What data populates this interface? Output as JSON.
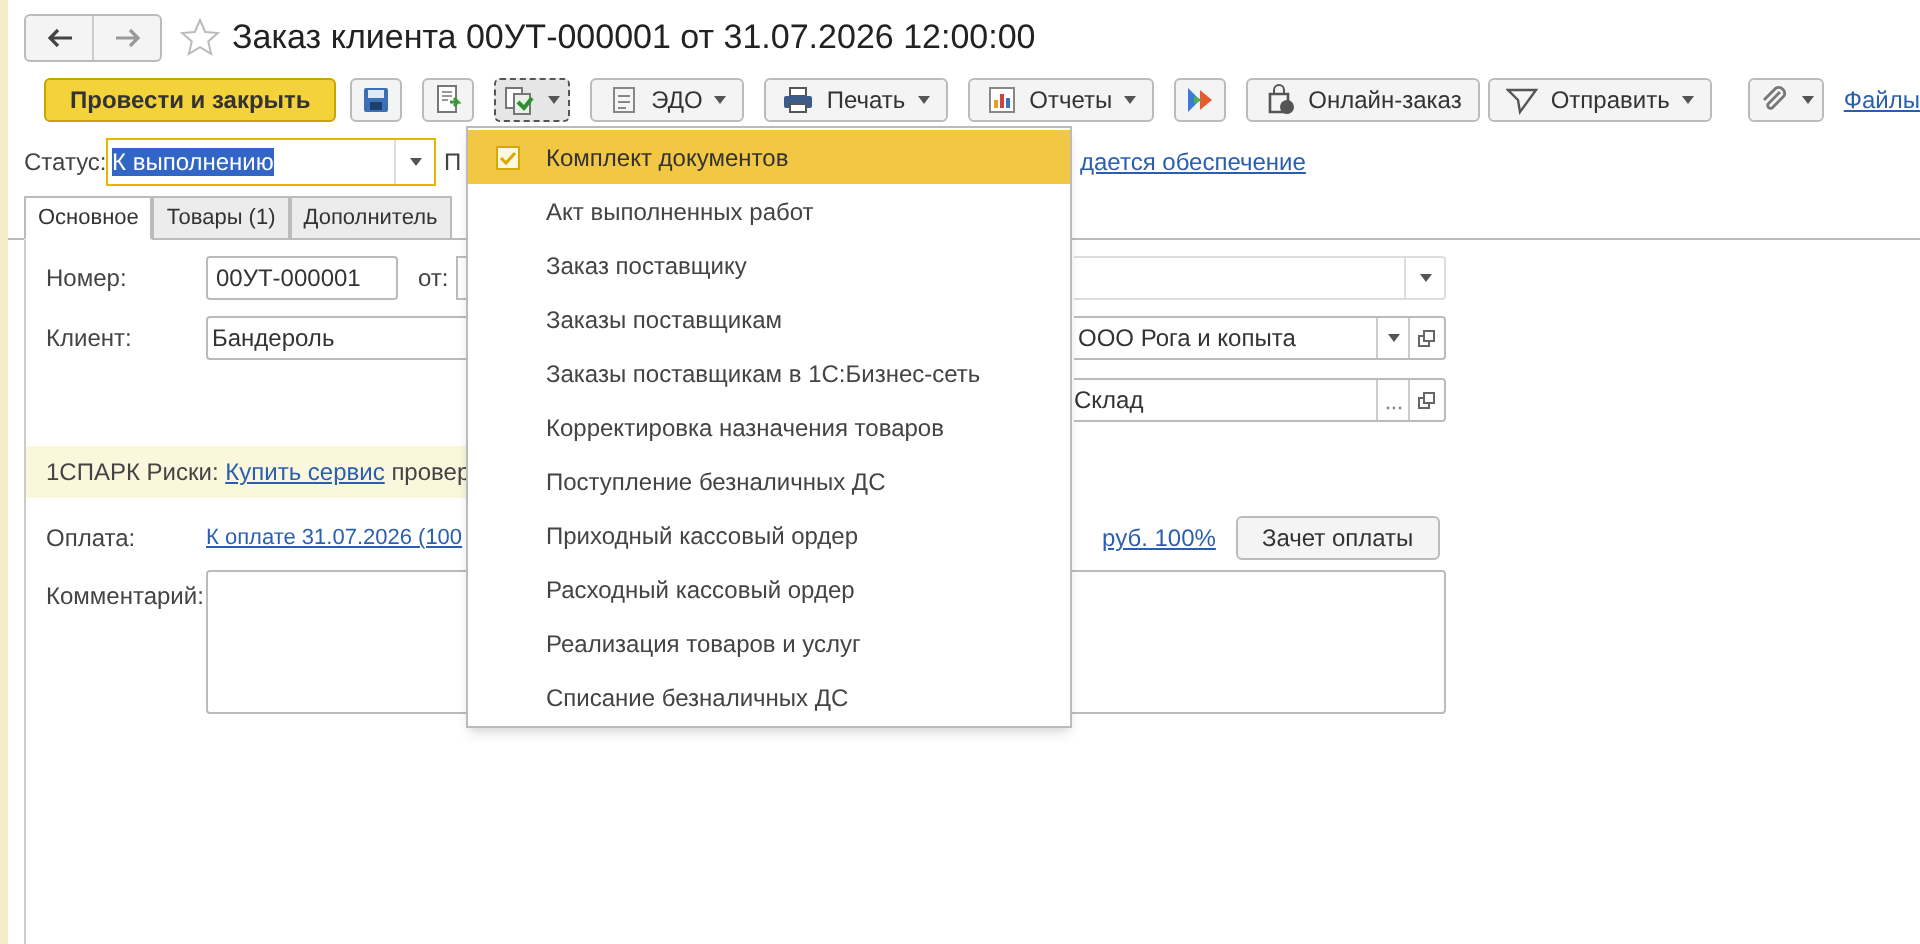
{
  "window": {
    "title": "Заказ клиента 00УТ-000001 от 31.07.2026 12:00:00",
    "favorite": false
  },
  "toolbar": [
    {
      "kind": "primary",
      "label": "Провести и закрыть"
    },
    {
      "kind": "icon"
    },
    {
      "kind": "icon"
    },
    {
      "kind": "menu-icon",
      "selected": true
    },
    {
      "kind": "dropdown",
      "label": "ЭДО"
    },
    {
      "kind": "dropdown",
      "label": "Печать"
    },
    {
      "kind": "dropdown",
      "label": "Отчеты"
    },
    {
      "kind": "icon"
    },
    {
      "kind": "button",
      "label": "Онлайн-заказ"
    },
    {
      "kind": "dropdown",
      "label": "Отправить"
    },
    {
      "kind": "menu-icon",
      "selected": false
    },
    {
      "kind": "link",
      "label": "Файлы"
    }
  ],
  "status": {
    "label": "Статус:",
    "value": "К выполнению",
    "next_label": "П",
    "link": "дается обеспечение"
  },
  "tabs": [
    {
      "label": "Основное",
      "selected": true
    },
    {
      "label": "Товары (1)",
      "selected": false
    },
    {
      "label": "Дополнитель",
      "selected": false
    }
  ],
  "form": {
    "number_label": "Номер:",
    "number": "00УТ-000001",
    "date_label": "от:",
    "client_label": "Клиент:",
    "client": "Бандероль",
    "organization": "ООО Рога и копыта",
    "warehouse": "Склад",
    "spark_label": "1СПАРК Риски:",
    "spark_link": "Купить сервис",
    "spark_text": "провер",
    "payment_label": "Оплата:",
    "payment_link": "К оплате 31.07.2026 (100",
    "payment_link_tail": "руб. 100%",
    "payment_button": "Зачет оплаты",
    "comment_label": "Комментарий:"
  },
  "menu": [
    {
      "label": "Комплект документов",
      "checked": true,
      "selected": true
    },
    {
      "label": "Акт выполненных работ",
      "checked": false,
      "selected": false
    },
    {
      "label": "Заказ поставщику",
      "checked": false,
      "selected": false
    },
    {
      "label": "Заказы поставщикам",
      "checked": false,
      "selected": false
    },
    {
      "label": "Заказы поставщикам в 1С:Бизнес-сеть",
      "checked": false,
      "selected": false
    },
    {
      "label": "Корректировка назначения товаров",
      "checked": false,
      "selected": false
    },
    {
      "label": "Поступление безналичных ДС",
      "checked": false,
      "selected": false
    },
    {
      "label": "Приходный кассовый ордер",
      "checked": false,
      "selected": false
    },
    {
      "label": "Расходный кассовый ордер",
      "checked": false,
      "selected": false
    },
    {
      "label": "Реализация товаров и услуг",
      "checked": false,
      "selected": false
    },
    {
      "label": "Списание безналичных ДС",
      "checked": false,
      "selected": false
    }
  ]
}
